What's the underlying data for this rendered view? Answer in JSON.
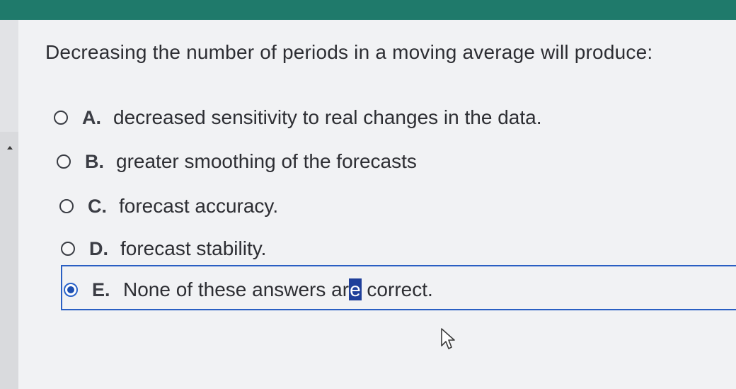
{
  "question": {
    "text": "Decreasing the number of periods in a moving average will produce:"
  },
  "options": [
    {
      "letter": "A.",
      "text": "decreased sensitivity to real changes in the data.",
      "selected": false
    },
    {
      "letter": "B.",
      "text": "greater smoothing of the forecasts",
      "selected": false
    },
    {
      "letter": "C.",
      "text": "forecast accuracy.",
      "selected": false
    },
    {
      "letter": "D.",
      "text": "forecast stability.",
      "selected": false
    },
    {
      "letter": "E.",
      "text_before": "None of these answers ar",
      "text_highlight": "e",
      "text_after": " correct.",
      "selected": true
    }
  ],
  "colors": {
    "top_bar": "#1f7a6b",
    "selection": "#2a5fc3",
    "background": "#f1f2f4"
  },
  "icons": {
    "scroll": "up-arrow-icon",
    "pointer": "mouse-pointer-icon"
  }
}
